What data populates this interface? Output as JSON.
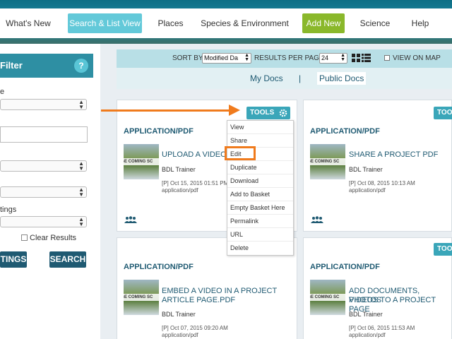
{
  "nav": {
    "items": [
      {
        "label": "What's New"
      },
      {
        "label": "Search & List View"
      },
      {
        "label": "Places"
      },
      {
        "label": "Species & Environment"
      },
      {
        "label": "Add New"
      },
      {
        "label": "Science"
      },
      {
        "label": "Help"
      }
    ],
    "active": "Search & List View",
    "accent_color": "#63c9d9",
    "add_new_color": "#8ab82b"
  },
  "sidebar": {
    "filter_title": "Filter",
    "help_label": "?",
    "label_1": "e",
    "label_2": "tings",
    "clear_results_label": "Clear Results",
    "settings_button": "TINGS",
    "search_button": "SEARCH"
  },
  "sortbar": {
    "sort_by_label": "SORT BY",
    "sort_by_value": "Modified Da",
    "results_per_page_label": "RESULTS PER PAGE",
    "results_per_page_value": "24",
    "view_on_map_label": "VIEW ON MAP"
  },
  "tabs": {
    "my_docs": "My Docs",
    "separator": "|",
    "public_docs": "Public Docs"
  },
  "cards": [
    {
      "tools": "TOOLS",
      "type": "APPLICATION/PDF",
      "thumb_text": "AGE COMING SC",
      "title_line1": "UPLOAD A VIDEO",
      "title_line2": "",
      "author": "BDL Trainer",
      "date": "[P] Oct 15, 2015 01:51 PM",
      "mime": "application/pdf"
    },
    {
      "tools": "TOO",
      "type": "APPLICATION/PDF",
      "thumb_text": "AGE COMING SC",
      "title_line1": "SHARE A PROJECT PDF",
      "title_line2": "",
      "author": "BDL Trainer",
      "date": "[P] Oct 08, 2015 10:13 AM",
      "mime": "application/pdf"
    },
    {
      "tools": "",
      "type": "APPLICATION/PDF",
      "thumb_text": "AGE COMING SC",
      "title_line1": "EMBED A VIDEO IN A PROJECT",
      "title_line2": "ARTICLE PAGE.PDF",
      "author": "BDL Trainer",
      "date": "[P] Oct 07, 2015 09:20 AM",
      "mime": "application/pdf"
    },
    {
      "tools": "TOO",
      "type": "APPLICATION/PDF",
      "thumb_text": "AGE COMING SC",
      "title_line1": "ADD DOCUMENTS, PHOTOS",
      "title_line2": "VIDEOS TO A PROJECT PAGE",
      "author": "BDL Trainer",
      "date": "[P] Oct 06, 2015 11:53 AM",
      "mime": "application/pdf"
    }
  ],
  "tools_menu": [
    "View",
    "Share",
    "Edit",
    "Duplicate",
    "Download",
    "Add to Basket",
    "Empty Basket Here",
    "Permalink",
    "URL",
    "Delete"
  ],
  "highlight_color": "#f07b1d",
  "icons": {
    "gear": "gear-icon",
    "grid": "grid-view-icon",
    "list": "list-view-icon",
    "people": "people-icon",
    "arrow": "arrow-icon"
  }
}
